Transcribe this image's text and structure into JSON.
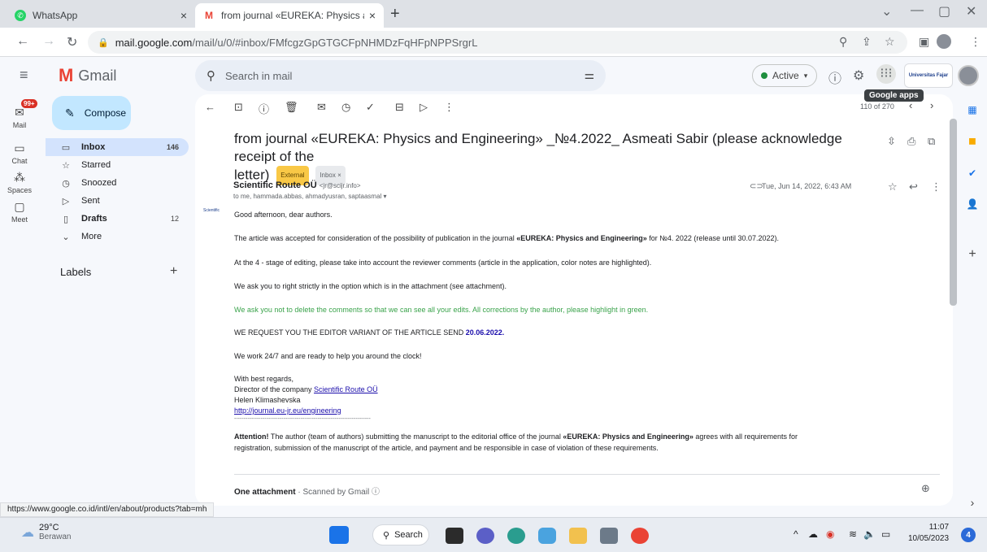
{
  "browser": {
    "tabs": [
      {
        "title": "WhatsApp",
        "close": "×"
      },
      {
        "title": "from journal «EUREKA: Physics ar",
        "close": "×"
      }
    ],
    "new_tab": "+",
    "url_host": "mail.google.com",
    "url_path": "/mail/u/0/#inbox/FMfcgzGpGTGCFpNHMDzFqHFpNPPSrgrL",
    "window_controls": [
      "⌄",
      "—",
      "▢",
      "✕"
    ]
  },
  "gmail": {
    "app_name": "Gmail",
    "search_placeholder": "Search in mail",
    "status": "Active",
    "tooltip": "Google apps",
    "account_org": "Universitas Fajar",
    "rail": [
      {
        "label": "Mail",
        "icon": "mail-icon"
      },
      {
        "label": "Chat",
        "icon": "chat-icon"
      },
      {
        "label": "Spaces",
        "icon": "spaces-icon"
      },
      {
        "label": "Meet",
        "icon": "meet-icon"
      }
    ],
    "mail_badge": "99+",
    "compose": "Compose",
    "nav": [
      {
        "label": "Inbox",
        "count": "146",
        "icon": "▭"
      },
      {
        "label": "Starred",
        "count": "",
        "icon": "☆"
      },
      {
        "label": "Snoozed",
        "count": "",
        "icon": "◷"
      },
      {
        "label": "Sent",
        "count": "",
        "icon": "▷"
      },
      {
        "label": "Drafts",
        "count": "12",
        "icon": "▯"
      },
      {
        "label": "More",
        "count": "",
        "icon": "⌄"
      }
    ],
    "labels_heading": "Labels"
  },
  "message": {
    "page_info": "110 of 270",
    "subject_line1": "from journal «EUREKA: Physics and Engineering» _№4.2022_ Asmeati Sabir (please acknowledge receipt of the",
    "subject_line2": "letter)",
    "tag_external": "External",
    "tag_inbox": "Inbox ×",
    "sender_name": "Scientific Route OÜ",
    "sender_email": "<jr@scijr.info>",
    "recipients": "to me, hammada.abbas, ahmadyusran, saptaasmal ▾",
    "date": "Tue, Jun 14, 2022, 6:43 AM",
    "sender_logo": "Scientific",
    "greeting": "Good afternoon, dear authors.",
    "p1_a": "The article was accepted for consideration of the possibility of publication in the journal ",
    "p1_b": "«EUREKA: Physics and Engineering»",
    "p1_c": "  for №4. 2022 (release until 30.07.2022).",
    "p2": "At the 4 - stage of editing, please take into account the reviewer comments  (article in the application, color notes are highlighted).",
    "p3": "We ask you to right strictly in the option which is in the attachment (see attachment).",
    "p4": "We ask you not to delete the comments so that we can see all your edits. All corrections by the author, please highlight in green.",
    "p5_a": "WE REQUEST YOU THE EDITOR VARIANT OF THE ARTICLE SEND ",
    "p5_b": "20.06.2022.",
    "p6": "We work 24/7 and are ready to help you around the clock!",
    "sig1": "With best regards,",
    "sig2_a": "Director of the company ",
    "sig2_b": "Scientific Route OÜ",
    "sig3": "Helen Klimashevska",
    "sig4": "http://journal.eu-jr.eu/engineering",
    "sig_rule": "------------------------------------------------------------------------",
    "att_a": "Attention!",
    "att_b": " The author (team of authors) submitting the manuscript to the editorial office of the journal ",
    "att_c": " «EUREKA: Physics and Engineering» ",
    "att_d": " agrees with all requirements for",
    "att_line2": "registration, submission of the manuscript of the article, and payment and be responsible in case of violation of these requirements.",
    "attachment_label": "One attachment",
    "attachment_scan": " · Scanned by Gmail ⓘ"
  },
  "status_url": "https://www.google.co.id/intl/en/about/products?tab=mh",
  "taskbar": {
    "temp": "29°C",
    "weather": "Berawan",
    "search": "Search",
    "time": "11:07",
    "date": "10/05/2023",
    "notifications": "4"
  }
}
